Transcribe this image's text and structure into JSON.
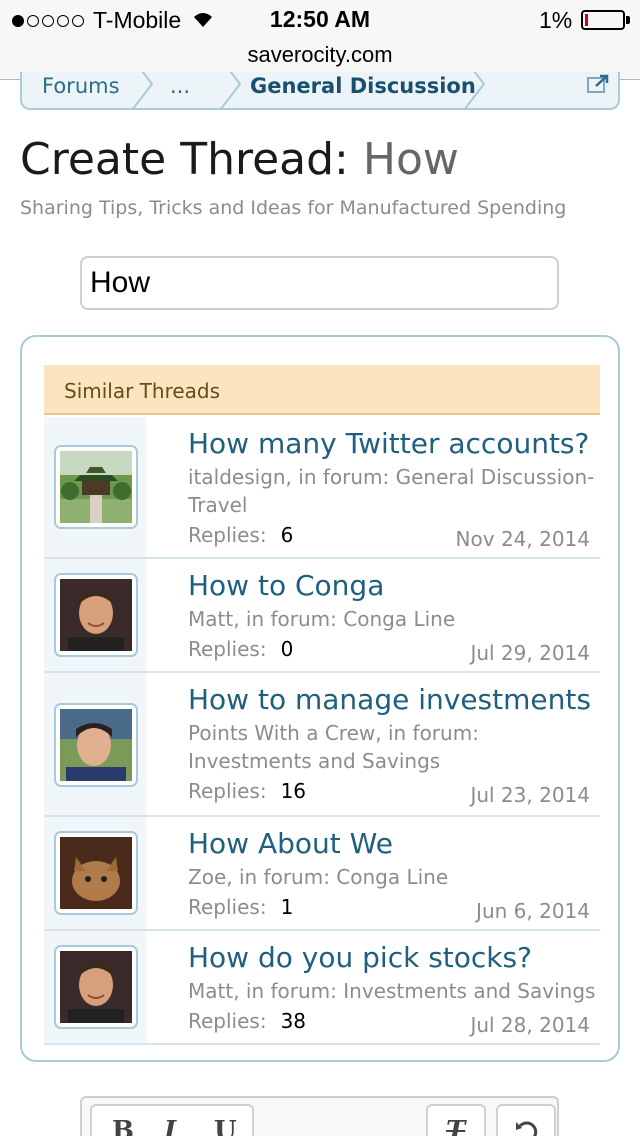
{
  "status_bar": {
    "carrier": "T-Mobile",
    "time": "12:50 AM",
    "battery_percent": "1%",
    "signal_icon": "signal-dots-icon",
    "wifi_icon": "wifi-icon",
    "battery_icon": "battery-icon"
  },
  "url_bar": {
    "domain": "saverocity.com"
  },
  "breadcrumb": {
    "items": [
      "Forums",
      "...",
      "General Discussion"
    ],
    "external_icon": "external-link-icon"
  },
  "page": {
    "title_prefix": "Create Thread:",
    "title_value": "How",
    "subtitle": "Sharing Tips, Tricks and Ideas for Manufactured Spending"
  },
  "thread_title_input": {
    "value": "How"
  },
  "similar_threads": {
    "header": "Similar Threads",
    "replies_label": "Replies:",
    "items": [
      {
        "title": "How many Twitter accounts?",
        "meta": "italdesign, in forum: General Discussion-Travel",
        "replies": "6",
        "date": "Nov 24, 2014",
        "avatar": "pagoda-photo"
      },
      {
        "title": "How to Conga",
        "meta": "Matt, in forum: Conga Line",
        "replies": "0",
        "date": "Jul 29, 2014",
        "avatar": "man-photo"
      },
      {
        "title": "How to manage investments",
        "meta": "Points With a Crew, in forum: Investments and Savings",
        "replies": "16",
        "date": "Jul 23, 2014",
        "avatar": "man-photo"
      },
      {
        "title": "How About We",
        "meta": "Zoe, in forum: Conga Line",
        "replies": "1",
        "date": "Jun 6, 2014",
        "avatar": "cat-photo"
      },
      {
        "title": "How do you pick stocks?",
        "meta": "Matt, in forum: Investments and Savings",
        "replies": "38",
        "date": "Jul 28, 2014",
        "avatar": "man-photo"
      }
    ]
  },
  "editor_toolbar": {
    "buttons": [
      "B",
      "I",
      "U",
      "T"
    ],
    "colors": {
      "accent": "#1f5f7f",
      "header_bg": "#fae5c0",
      "border": "#a9cbd9"
    }
  }
}
